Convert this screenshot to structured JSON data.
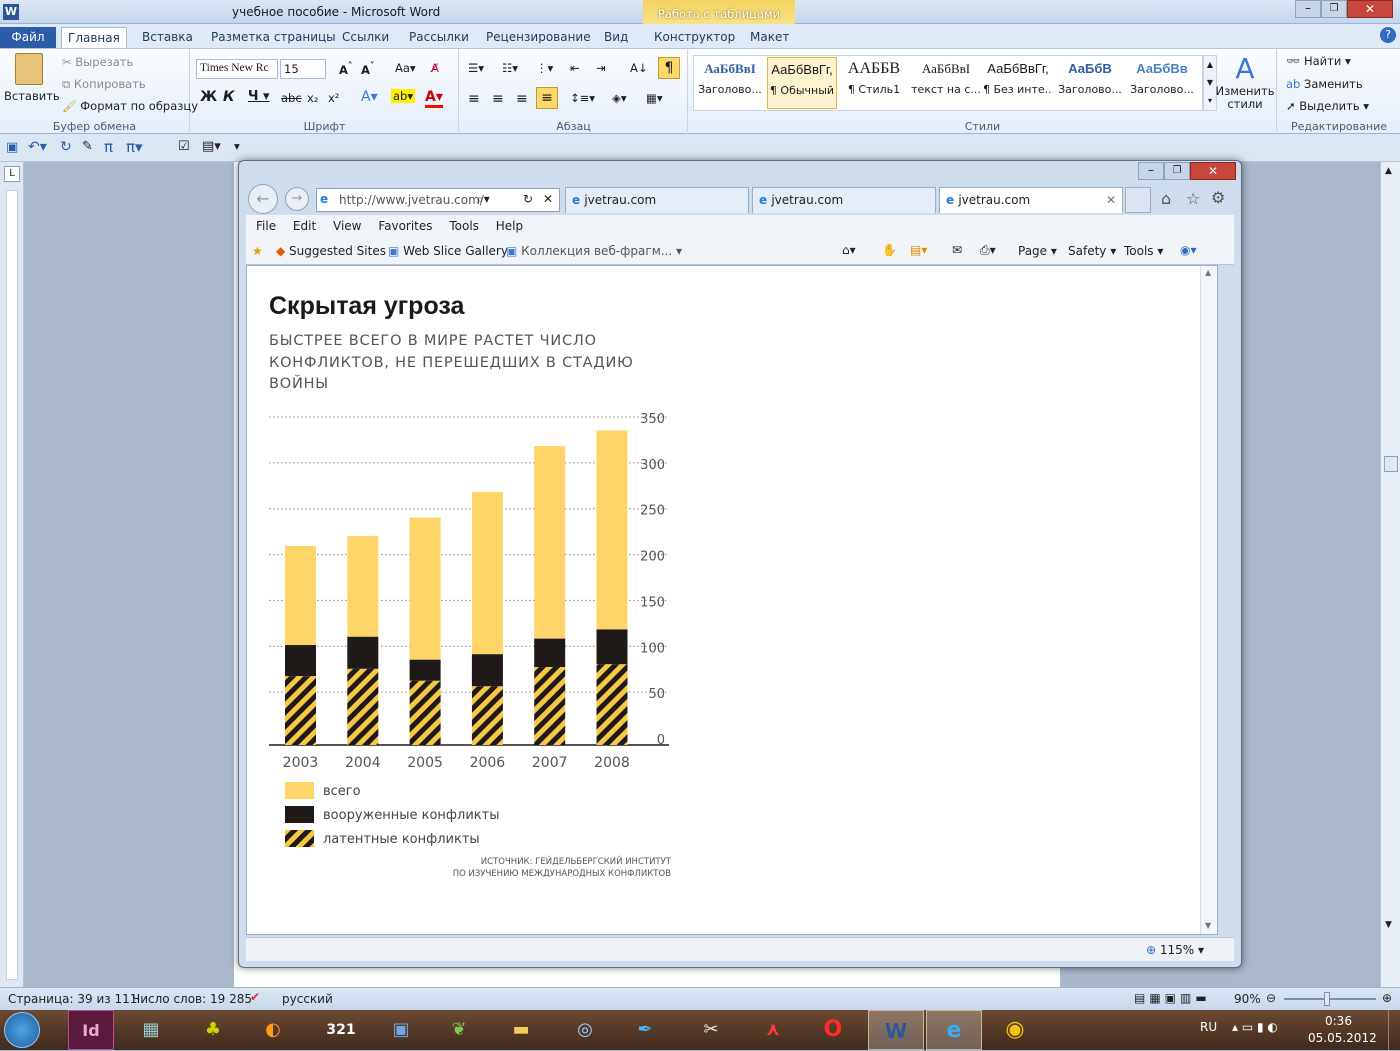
{
  "word": {
    "title": "учебное пособие  -  Microsoft Word",
    "context_tab": "Работа с таблицами",
    "tabs": [
      "Файл",
      "Главная",
      "Вставка",
      "Разметка страницы",
      "Ссылки",
      "Рассылки",
      "Рецензирование",
      "Вид",
      "Конструктор",
      "Макет"
    ],
    "clipboard": {
      "paste": "Вставить",
      "cut": "Вырезать",
      "copy": "Копировать",
      "format_painter": "Формат по образцу",
      "group": "Буфер обмена"
    },
    "font": {
      "name": "Times New Rc",
      "size": "15",
      "group": "Шрифт"
    },
    "paragraph": {
      "group": "Абзац"
    },
    "styles": {
      "items": [
        {
          "sample": "АаБбВвI",
          "name": "Заголово..."
        },
        {
          "sample": "АаБбВвГг,",
          "name": "¶ Обычный"
        },
        {
          "sample": "ААББВ",
          "name": "¶ Стиль1"
        },
        {
          "sample": "АаБбВвI",
          "name": "текст на с..."
        },
        {
          "sample": "АаБбВвГг,",
          "name": "¶ Без инте..."
        },
        {
          "sample": "АаБбВ",
          "name": "Заголово..."
        },
        {
          "sample": "АаБбВв",
          "name": "Заголово..."
        }
      ],
      "change": "Изменить стили",
      "group": "Стили"
    },
    "editing": {
      "find": "Найти",
      "replace": "Заменить",
      "select": "Выделить",
      "group": "Редактирование"
    },
    "status": {
      "page": "Страница: 39 из 111",
      "words": "Число слов: 19 285",
      "lang": "русский",
      "zoom": "90%"
    }
  },
  "ie": {
    "address": "http://www.jvetrau.com/",
    "tabs": [
      "jvetrau.com",
      "jvetrau.com",
      "jvetrau.com"
    ],
    "menu": [
      "File",
      "Edit",
      "View",
      "Favorites",
      "Tools",
      "Help"
    ],
    "fav": {
      "suggested": "Suggested Sites",
      "slice": "Web Slice Gallery",
      "coll": "Коллекция веб-фрагм..."
    },
    "cmd": {
      "page": "Page",
      "safety": "Safety",
      "tools": "Tools"
    },
    "zoom": "115%"
  },
  "taskbar": {
    "lang": "RU",
    "time": "0:36",
    "date": "05.05.2012"
  },
  "chart_data": {
    "type": "bar",
    "title": "Скрытая угроза",
    "subtitle": "БЫСТРЕЕ ВСЕГО В МИРЕ РАСТЕТ ЧИСЛО КОНФЛИКТОВ, НЕ ПЕРЕШЕДШИХ В СТАДИЮ ВОЙНЫ",
    "categories": [
      "2003",
      "2004",
      "2005",
      "2006",
      "2007",
      "2008"
    ],
    "yticks": [
      "0",
      "50",
      "100",
      "150",
      "200",
      "250",
      "300",
      "350"
    ],
    "ylim": [
      0,
      350
    ],
    "series": [
      {
        "name": "всего",
        "color": "#ffd56a",
        "values": [
          217,
          228,
          248,
          276,
          326,
          343
        ]
      },
      {
        "name": "вооруженные конфликты",
        "color": "#1f1a17",
        "values": [
          109,
          118,
          93,
          99,
          116,
          126
        ]
      },
      {
        "name": "латентные конфликты",
        "color": "#f6c646",
        "values": [
          75,
          83,
          70,
          64,
          85,
          88
        ]
      }
    ],
    "source": [
      "ИСТОЧНИК: ГЕЙДЕЛЬБЕРГСКИЙ ИНСТИТУТ",
      "ПО ИЗУЧЕНИЮ МЕЖДУНАРОДНЫХ КОНФЛИКТОВ"
    ]
  }
}
